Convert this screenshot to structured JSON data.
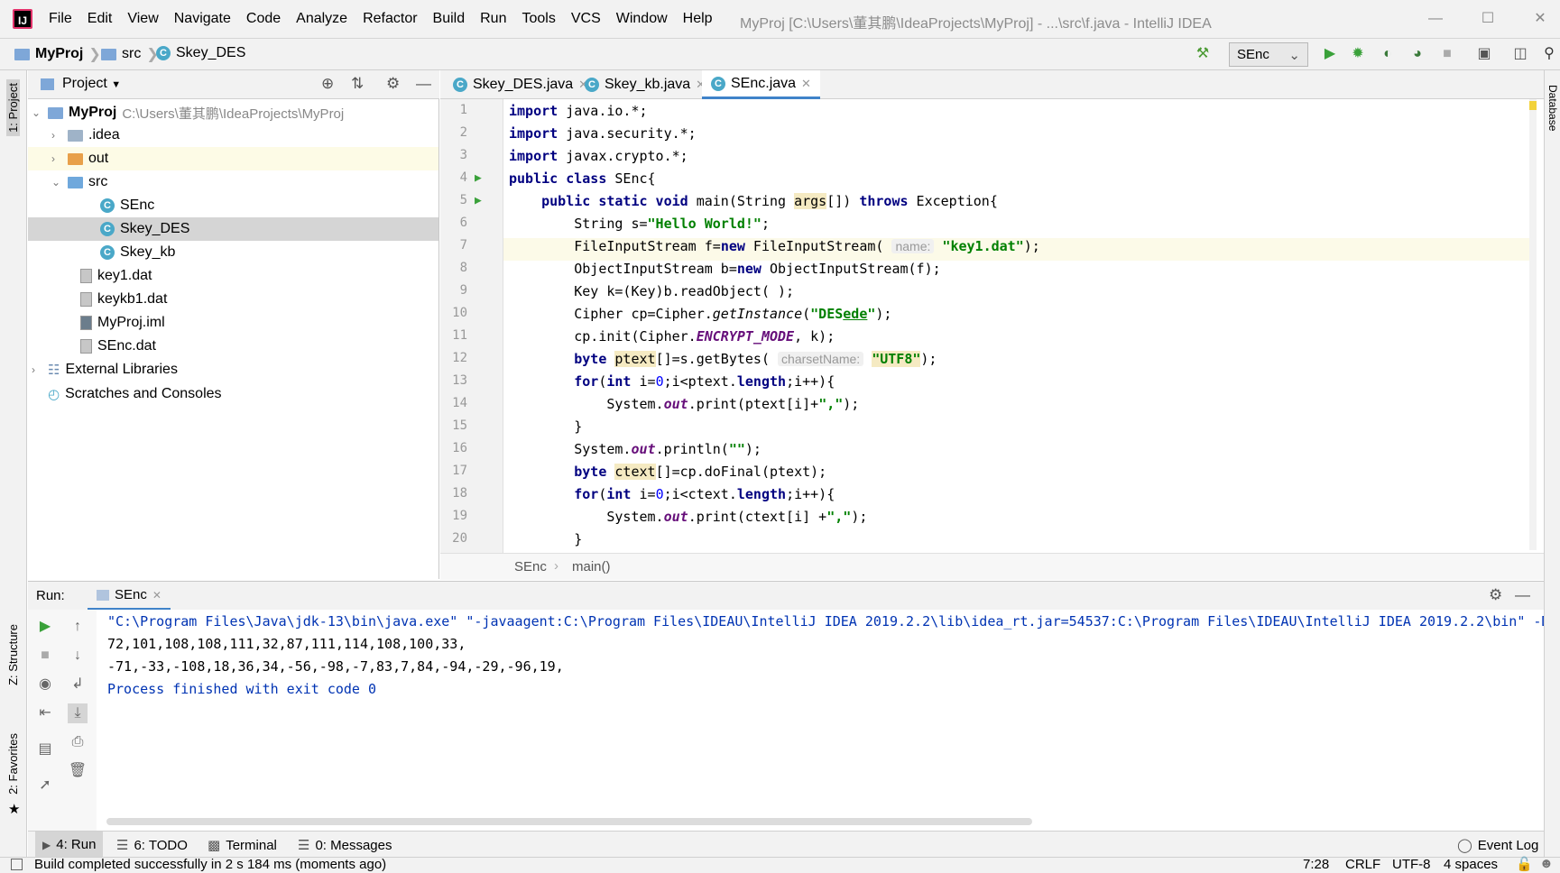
{
  "window": {
    "title": "MyProj [C:\\Users\\董其鹏\\IdeaProjects\\MyProj] - ...\\src\\f.java - IntelliJ IDEA",
    "menu": [
      "File",
      "Edit",
      "View",
      "Navigate",
      "Code",
      "Analyze",
      "Refactor",
      "Build",
      "Run",
      "Tools",
      "VCS",
      "Window",
      "Help"
    ]
  },
  "navbar": {
    "crumbs": [
      "MyProj",
      "src",
      "Skey_DES"
    ],
    "run_config": "SEnc"
  },
  "left_stripe": {
    "project": "1: Project",
    "structure": "Z: Structure",
    "favorites": "2: Favorites"
  },
  "right_stripe": {
    "database": "Database"
  },
  "project_panel": {
    "title": "Project",
    "root": {
      "name": "MyProj",
      "path": "C:\\Users\\董其鹏\\IdeaProjects\\MyProj"
    },
    "items": [
      ".idea",
      "out",
      "src",
      "SEnc",
      "Skey_DES",
      "Skey_kb",
      "key1.dat",
      "keykb1.dat",
      "MyProj.iml",
      "SEnc.dat",
      "External Libraries",
      "Scratches and Consoles"
    ]
  },
  "editor": {
    "tabs": [
      "Skey_DES.java",
      "Skey_kb.java",
      "SEnc.java"
    ],
    "active_tab": "SEnc.java",
    "lines": [
      {
        "n": "1",
        "code": "import java.io.*;"
      },
      {
        "n": "2",
        "code": "import java.security.*;"
      },
      {
        "n": "3",
        "code": "import javax.crypto.*;"
      },
      {
        "n": "4",
        "code": "public class SEnc{"
      },
      {
        "n": "5",
        "code": "    public static void main(String args[]) throws Exception{"
      },
      {
        "n": "6",
        "code": "        String s=\"Hello World!\";"
      },
      {
        "n": "7",
        "code": "        FileInputStream f=new FileInputStream( name: \"key1.dat\");"
      },
      {
        "n": "8",
        "code": "        ObjectInputStream b=new ObjectInputStream(f);"
      },
      {
        "n": "9",
        "code": "        Key k=(Key)b.readObject( );"
      },
      {
        "n": "10",
        "code": "        Cipher cp=Cipher.getInstance(\"DESede\");"
      },
      {
        "n": "11",
        "code": "        cp.init(Cipher.ENCRYPT_MODE, k);"
      },
      {
        "n": "12",
        "code": "        byte ptext[]=s.getBytes( charsetName: \"UTF8\");"
      },
      {
        "n": "13",
        "code": "        for(int i=0;i<ptext.length;i++){"
      },
      {
        "n": "14",
        "code": "            System.out.print(ptext[i]+\",\");"
      },
      {
        "n": "15",
        "code": "        }"
      },
      {
        "n": "16",
        "code": "        System.out.println(\"\");"
      },
      {
        "n": "17",
        "code": "        byte ctext[]=cp.doFinal(ptext);"
      },
      {
        "n": "18",
        "code": "        for(int i=0;i<ctext.length;i++){"
      },
      {
        "n": "19",
        "code": "            System.out.print(ctext[i] +\",\");"
      },
      {
        "n": "20",
        "code": "        }"
      }
    ],
    "breadcrumb": [
      "SEnc",
      "main()"
    ]
  },
  "run_panel": {
    "label": "Run:",
    "tab": "SEnc",
    "output": [
      "\"C:\\Program Files\\Java\\jdk-13\\bin\\java.exe\" \"-javaagent:C:\\Program Files\\IDEAU\\IntelliJ IDEA 2019.2.2\\lib\\idea_rt.jar=54537:C:\\Program Files\\IDEAU\\IntelliJ IDEA 2019.2.2\\bin\" -D",
      "72,101,108,108,111,32,87,111,114,108,100,33,",
      "-71,-33,-108,18,36,34,-56,-98,-7,83,7,84,-94,-29,-96,19,",
      "Process finished with exit code 0"
    ]
  },
  "tool_windows": [
    "4: Run",
    "6: TODO",
    "Terminal",
    "0: Messages"
  ],
  "event_log": "Event Log",
  "status": {
    "message": "Build completed successfully in 2 s 184 ms (moments ago)",
    "position": "7:28",
    "line_sep": "CRLF",
    "encoding": "UTF-8",
    "indent": "4 spaces"
  },
  "colors": {
    "keyword": "#000080",
    "string": "#008000",
    "accent": "#4083c9",
    "selection": "#d5d5d5"
  }
}
